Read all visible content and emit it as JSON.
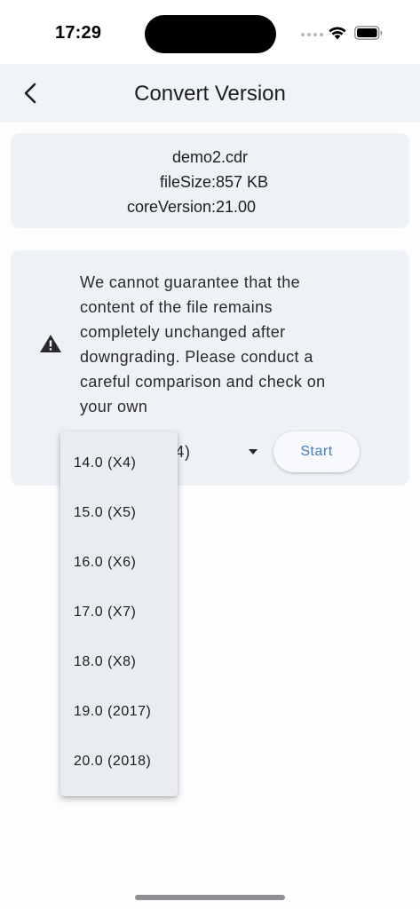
{
  "status_bar": {
    "time": "17:29"
  },
  "header": {
    "title": "Convert Version"
  },
  "file_info": {
    "name": "demo2.cdr",
    "size_label": "fileSize:",
    "size_value": "857 KB",
    "core_label": "coreVersion:",
    "core_value": "21.00"
  },
  "warning": {
    "lines": [
      "We cannot guarantee that the",
      "content of the file remains",
      "completely unchanged after",
      "downgrading. Please conduct a",
      "careful comparison and check on",
      "your own"
    ]
  },
  "version_select": {
    "visible_value": "0 (X4)"
  },
  "start_button": {
    "label": "Start"
  },
  "dropdown": {
    "options": [
      "14.0 (X4)",
      "15.0 (X5)",
      "16.0 (X6)",
      "17.0 (X7)",
      "18.0 (X8)",
      "19.0 (2017)",
      "20.0 (2018)"
    ]
  },
  "icons": {
    "back": "chevron-left-icon",
    "warning": "warning-triangle-icon",
    "dropdown_arrow": "caret-down-icon",
    "wifi": "wifi-icon",
    "battery": "battery-icon"
  },
  "colors": {
    "accent": "#3e7ec4",
    "app_bar": "#f0f4f8",
    "card": "#eef2f6",
    "menu": "#e9edf1"
  }
}
